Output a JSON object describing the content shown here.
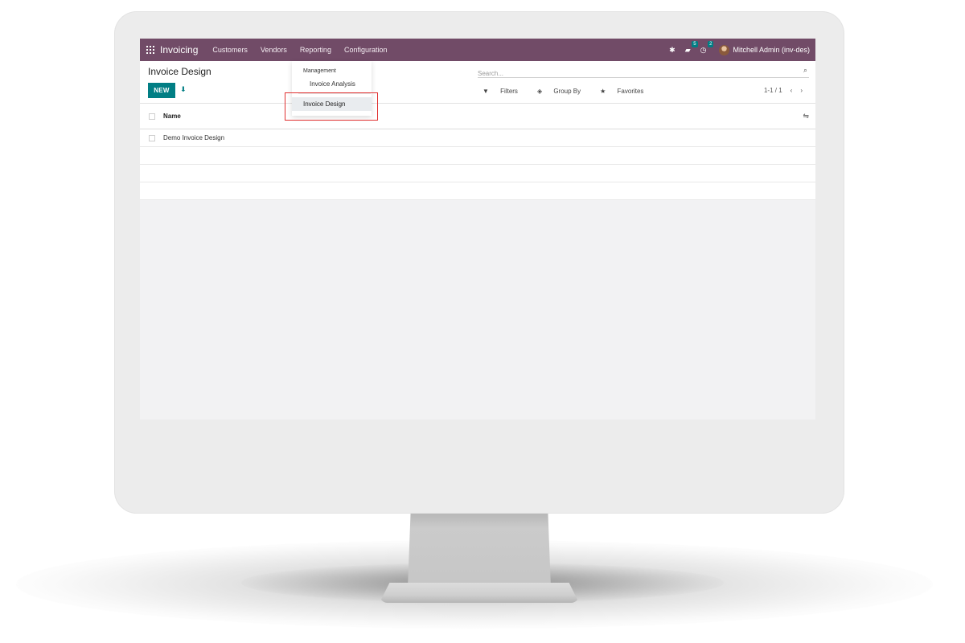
{
  "navbar": {
    "app_name": "Invoicing",
    "menu": [
      "Customers",
      "Vendors",
      "Reporting",
      "Configuration"
    ],
    "messages_count": "5",
    "activities_count": "2",
    "user": "Mitchell Admin (inv-des)"
  },
  "control_panel": {
    "title": "Invoice Design",
    "new_button": "NEW",
    "search_placeholder": "Search...",
    "filters": "Filters",
    "group_by": "Group By",
    "favorites": "Favorites",
    "pager": "1-1 / 1"
  },
  "list": {
    "column_name": "Name",
    "rows": [
      "Demo Invoice Design"
    ]
  },
  "reporting_dropdown": {
    "section": "Management",
    "items": [
      "Invoice Analysis",
      "Invoice Design"
    ]
  },
  "colors": {
    "navbar": "#714b67",
    "primary": "#017e84",
    "highlight_border": "#e03131"
  },
  "icons": [
    "apps-icon",
    "bug-icon",
    "chat-icon",
    "clock-icon",
    "avatar",
    "download-icon",
    "search-icon",
    "filter-icon",
    "layers-icon",
    "star-icon",
    "chevron-left-icon",
    "chevron-right-icon",
    "settings-sliders-icon"
  ]
}
